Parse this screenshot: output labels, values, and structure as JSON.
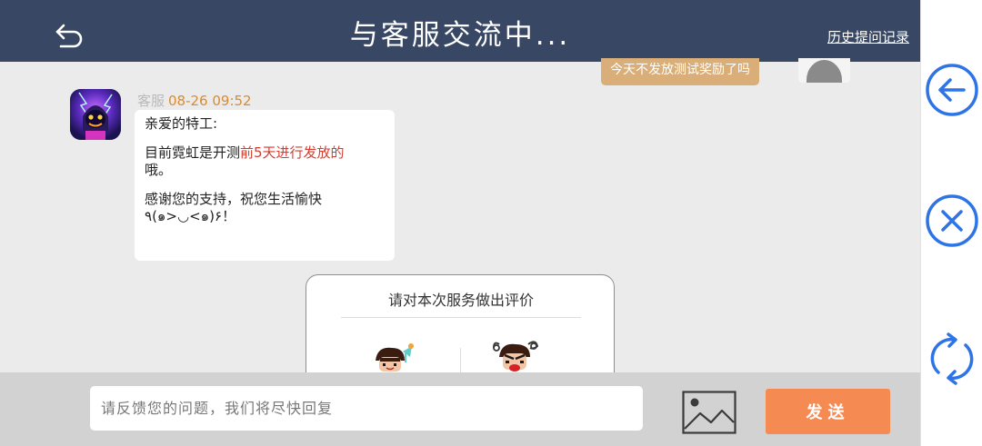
{
  "header": {
    "title": "与客服交流中...",
    "history_link": "历史提问记录"
  },
  "user_message": {
    "text": "今天不发放测试奖励了吗"
  },
  "agent_message": {
    "sender": "客服",
    "time": "08-26 09:52",
    "greeting": "亲爱的特工:",
    "body_prefix": "目前霓虹是开测",
    "body_highlight": "前5天进行发放的",
    "body_suffix": "哦。",
    "closing_line1": "感谢您的支持，祝您生活愉快",
    "closing_line2": "٩(๑>◡<๑)۶！"
  },
  "rating": {
    "title": "请对本次服务做出评价"
  },
  "input": {
    "placeholder": "请反馈您的问题，我们将尽快回复",
    "value": ""
  },
  "send_button": {
    "label": "发送"
  },
  "colors": {
    "header_bg": "#384764",
    "send_button": "#f58a52",
    "user_bubble": "#d9ae78",
    "side_icons": "#2f74e6",
    "highlight_text": "#d63b2e"
  },
  "icons": {
    "back": "undo-arrow-icon",
    "image": "image-icon",
    "side_back": "circle-arrow-left-icon",
    "side_close": "circle-close-icon",
    "side_refresh": "refresh-icon"
  }
}
